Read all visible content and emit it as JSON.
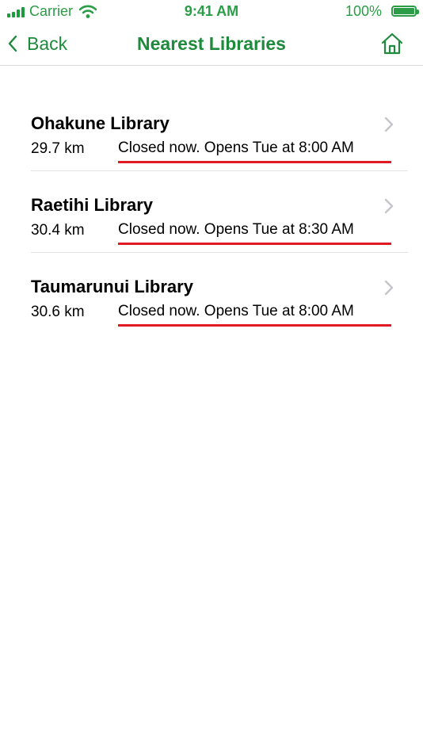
{
  "status_bar": {
    "carrier": "Carrier",
    "time": "9:41 AM",
    "battery": "100%"
  },
  "nav": {
    "back_label": "Back",
    "title": "Nearest Libraries"
  },
  "libraries": [
    {
      "name": "Ohakune Library",
      "distance": "29.7 km",
      "hours": "Closed now. Opens Tue at 8:00 AM"
    },
    {
      "name": "Raetihi Library",
      "distance": "30.4 km",
      "hours": "Closed now. Opens Tue at 8:30 AM"
    },
    {
      "name": "Taumarunui Library",
      "distance": "30.6 km",
      "hours": "Closed now. Opens Tue at 8:00 AM"
    }
  ],
  "colors": {
    "accent": "#1e8a3c",
    "underline": "#e01a22"
  }
}
